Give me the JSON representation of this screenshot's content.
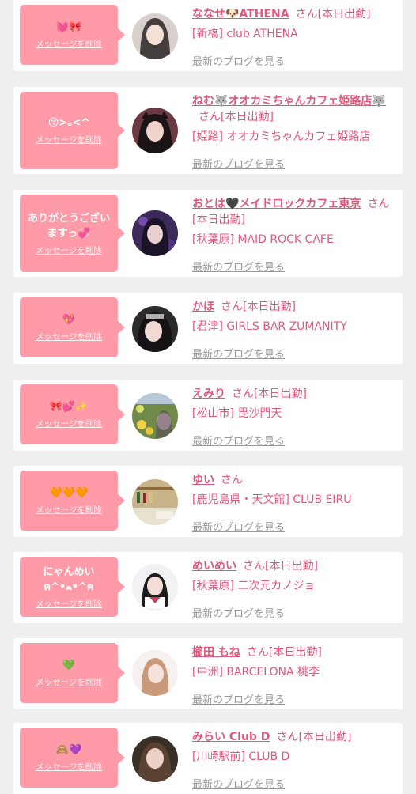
{
  "delete_label": "メッセージを削除",
  "san_label": "さん",
  "blog_label": "最新のブログを見る",
  "colors": {
    "accent": "#e0577b",
    "bubble": "#ff9aa9",
    "background": "#efefef"
  },
  "cards": [
    {
      "message": "💓🎀",
      "name": "ななせ🐶ATHENA",
      "schedule": "[本日出勤]",
      "shop": "[新橋] club ATHENA"
    },
    {
      "message": "😚>ₒ<^",
      "name": "ねむ🐺オオカミちゃんカフェ姫路店🐺",
      "schedule": "[本日出勤]",
      "shop": "[姫路] オオカミちゃんカフェ姫路店"
    },
    {
      "message": "ありがとうございますっ💞",
      "name": "おとは🖤メイドロックカフェ東京",
      "schedule": "[本日出勤]",
      "shop": "[秋葉原] MAID ROCK CAFE"
    },
    {
      "message": "💖",
      "name": "かほ",
      "schedule": "[本日出勤]",
      "shop": "[君津] GIRLS BAR ZUMANITY"
    },
    {
      "message": "🎀💕✨",
      "name": "えみり",
      "schedule": "[本日出勤]",
      "shop": "[松山市] 毘沙門天"
    },
    {
      "message": "🧡🧡🧡",
      "name": "ゆい",
      "schedule": "",
      "shop": "[鹿児島県・天文館] CLUB EIRU"
    },
    {
      "message": "にゃんめい ฅ^•ﻌ•^ฅ",
      "name": "めいめい",
      "schedule": "[本日出勤]",
      "shop": "[秋葉原] 二次元カノジョ"
    },
    {
      "message": "💚",
      "name": "櫛田 もね",
      "schedule": "[本日出勤]",
      "shop": "[中洲] BARCELONA 桃李"
    },
    {
      "message": "🙈💜",
      "name": "みらい Club D",
      "schedule": "[本日出勤]",
      "shop": "[川崎駅前] CLUB D"
    }
  ]
}
